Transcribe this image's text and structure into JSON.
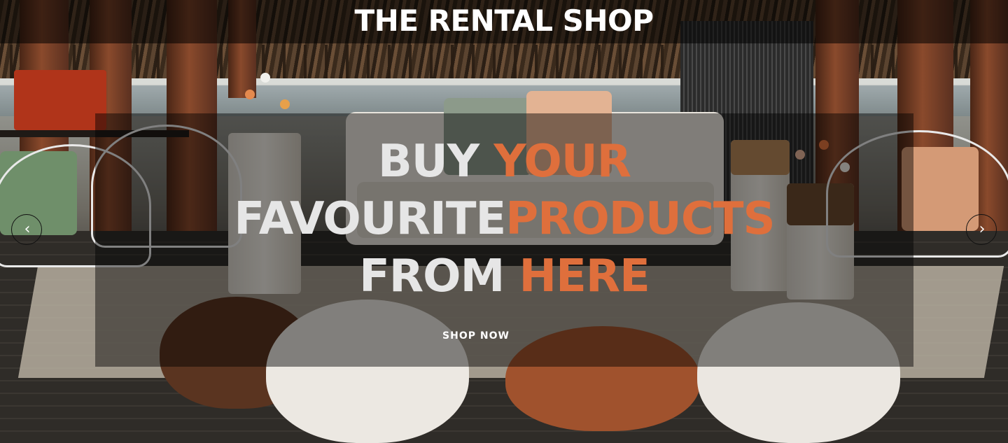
{
  "header": {
    "title": "THE RENTAL SHOP"
  },
  "hero": {
    "headline": {
      "line1_white": "BUY",
      "line1_accent": "YOUR",
      "line2_white": "FAVOURITE",
      "line2_accent": "PRODUCTS",
      "line3_white": "FROM",
      "line3_accent": "HERE"
    },
    "cta_label": "SHOP NOW",
    "prev_icon": "chevron-left-icon",
    "next_icon": "chevron-right-icon",
    "prev_glyph": "‹",
    "next_glyph": "›"
  },
  "colors": {
    "accent": "#df6f3c",
    "headline_white": "#e6e6e6",
    "overlay": "rgba(0,0,0,0.45)"
  }
}
